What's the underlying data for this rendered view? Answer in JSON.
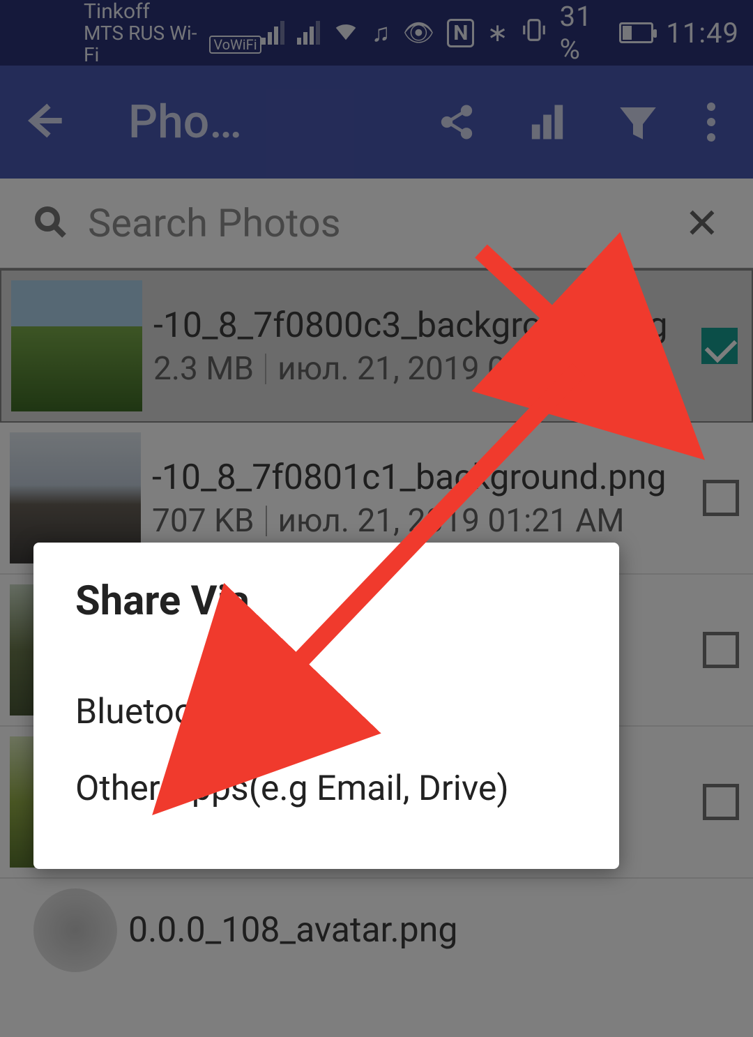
{
  "status": {
    "carrier1": "Tinkoff",
    "carrier2": "MTS RUS Wi-Fi",
    "vowifi": "VoWiFi",
    "battery_text": "31 %",
    "time": "11:49"
  },
  "appbar": {
    "title": "Pho…"
  },
  "search": {
    "placeholder": "Search Photos"
  },
  "files": [
    {
      "name": "-10_8_7f0800c3_background.png",
      "size": "2.3 MB",
      "date": "июл. 21, 2019 07:32 AM",
      "selected": true
    },
    {
      "name": "-10_8_7f0801c1_background.png",
      "size": "707 KB",
      "date": "июл. 21, 2019 01:21 AM",
      "selected": false
    },
    {
      "name": "",
      "size": "",
      "date": "",
      "selected": false
    },
    {
      "name": "",
      "size": "",
      "date": "",
      "selected": false
    },
    {
      "name": "0.0.0_108_avatar.png",
      "size": "",
      "date": "",
      "selected": false
    }
  ],
  "dialog": {
    "title": "Share Via",
    "option_bluetooth": "Bluetooth",
    "option_other": "Other Apps(e.g Email, Drive)"
  }
}
